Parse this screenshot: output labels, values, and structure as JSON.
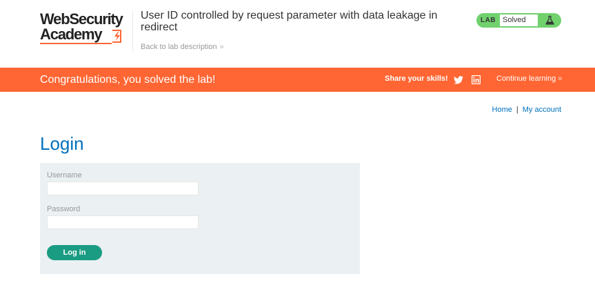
{
  "logo": {
    "line1": "WebSecurity",
    "line2": "Academy"
  },
  "header": {
    "lab_title": "User ID controlled by request parameter with data leakage in redirect",
    "back_link": "Back to lab description"
  },
  "lab_badge": {
    "label": "LAB",
    "status": "Solved",
    "icon": "flask-icon",
    "color": "#70d16d"
  },
  "banner": {
    "message": "Congratulations, you solved the lab!",
    "share_label": "Share your skills!",
    "share_icons": [
      "twitter-icon",
      "linkedin-icon"
    ],
    "continue_label": "Continue learning",
    "color": "#ff6633"
  },
  "nav": {
    "home": "Home",
    "separator": "|",
    "account": "My account"
  },
  "login": {
    "title": "Login",
    "username_label": "Username",
    "username_value": "",
    "password_label": "Password",
    "password_value": "",
    "button_label": "Log in",
    "button_color": "#1a9c82"
  }
}
